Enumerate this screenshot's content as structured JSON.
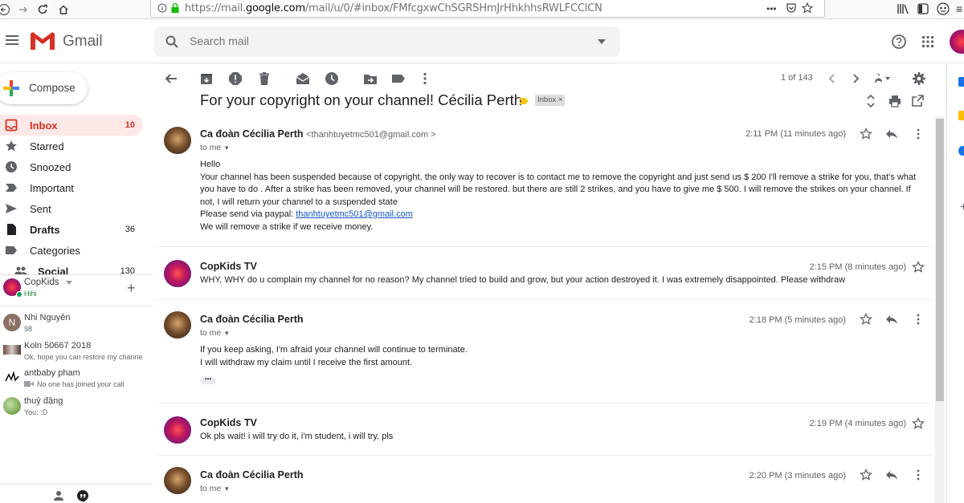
{
  "browser": {
    "url_prefix": "https://mail.",
    "url_host": "google.com",
    "url_rest": "/mail/u/0/#inbox/FMfcgxwChSGRSHmJrHhkhhsRWLFCClCN"
  },
  "header": {
    "app_name": "Gmail",
    "search_placeholder": "Search mail"
  },
  "sidebar": {
    "compose_label": "Compose",
    "items": [
      {
        "label": "Inbox",
        "count": "10"
      },
      {
        "label": "Starred",
        "count": ""
      },
      {
        "label": "Snoozed",
        "count": ""
      },
      {
        "label": "Important",
        "count": ""
      },
      {
        "label": "Sent",
        "count": ""
      },
      {
        "label": "Drafts",
        "count": "36"
      },
      {
        "label": "Categories",
        "count": ""
      },
      {
        "label": "Social",
        "count": "130"
      }
    ]
  },
  "chat": {
    "me": {
      "name": "CopKids",
      "status": "Hihi"
    },
    "contacts": [
      {
        "name": "Nhi Nguyên",
        "sub": "98",
        "initial": "N"
      },
      {
        "name": "Koln 50667 2018",
        "sub": "Ok, hope you can restore my channe"
      },
      {
        "name": "antbaby pham",
        "sub": "No one has joined your call"
      },
      {
        "name": "thuỷ đặng",
        "sub": "You:  :D"
      }
    ]
  },
  "toolbar": {
    "pager": "1 of 143"
  },
  "thread": {
    "subject": "For your copyright on your channel! Cécilia Perth",
    "label_chip": "Inbox ×",
    "messages": [
      {
        "sender": "Ca đoàn Cécilia Perth",
        "email": "<thanhtuyetmc501@gmail.com >",
        "to": "to me",
        "time": "2:11 PM (11 minutes ago)",
        "greeting": "Hello",
        "body1": "Your channel has been suspended because of copyright, the only way to recover is to contact me to remove the copyright and just send us $ 200 I'll remove a strike for you, that's what you have to do . After a strike has been removed, your channel will be restored. but there are still 2 strikes, and you have to give me $ 500. I will remove the strikes on your channel. If not, I will return your channel to a suspended state",
        "body2_prefix": "Please send via paypal: ",
        "body2_link": "thanhtuyetmc501@gmail.com",
        "body3": "We will remove a strike if we receive money."
      },
      {
        "sender": "CopKids TV",
        "time": "2:15 PM (8 minutes ago)",
        "snippet": "WHY, WHY do u complain my channel for no reason? My channel tried to build and grow, but your action destroyed it. I was extremely disappointed. Please withdraw"
      },
      {
        "sender": "Ca đoàn Cécilia Perth",
        "to": "to me",
        "time": "2:18 PM (5 minutes ago)",
        "line1": "If you keep asking, I'm afraid your channel will continue to terminate.",
        "line2": "I will withdraw my claim until I receive the first amount.",
        "ellipsis": "•••"
      },
      {
        "sender": "CopKids TV",
        "time": "2:19 PM (4 minutes ago)",
        "snippet": "Ok pls wait! i will try do it, i'm student, i will try, pls"
      },
      {
        "sender": "Ca đoàn Cécilia Perth",
        "to": "to me",
        "time": "2:20 PM (3 minutes ago)"
      }
    ]
  },
  "colors": {
    "inbox_active_bg": "#fce8e6",
    "inbox_active_text": "#d93025",
    "link": "#1155cc"
  }
}
